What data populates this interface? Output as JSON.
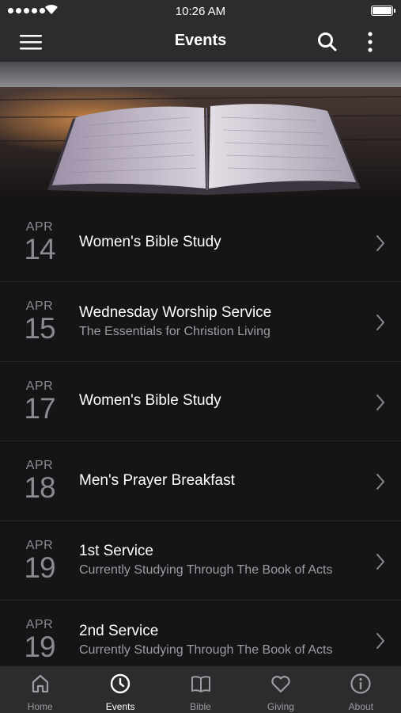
{
  "status_bar": {
    "time": "10:26 AM"
  },
  "nav": {
    "title": "Events",
    "menu_icon": "hamburger-menu-icon",
    "search_icon": "search-icon",
    "more_icon": "more-vertical-icon"
  },
  "hero": {
    "image": "open-bible-on-wooden-table-at-sunset"
  },
  "events": [
    {
      "month": "APR",
      "day": "14",
      "title": "Women's Bible Study",
      "subtitle": ""
    },
    {
      "month": "APR",
      "day": "15",
      "title": "Wednesday Worship Service",
      "subtitle": "The Essentials for Christion Living"
    },
    {
      "month": "APR",
      "day": "17",
      "title": "Women's Bible Study",
      "subtitle": ""
    },
    {
      "month": "APR",
      "day": "18",
      "title": "Men's Prayer Breakfast",
      "subtitle": ""
    },
    {
      "month": "APR",
      "day": "19",
      "title": "1st Service",
      "subtitle": "Currently Studying Through The Book of Acts"
    },
    {
      "month": "APR",
      "day": "19",
      "title": "2nd Service",
      "subtitle": "Currently Studying Through The Book of Acts"
    }
  ],
  "tabs": [
    {
      "label": "Home",
      "icon": "home-icon",
      "active": false
    },
    {
      "label": "Events",
      "icon": "clock-icon",
      "active": true
    },
    {
      "label": "Bible",
      "icon": "book-icon",
      "active": false
    },
    {
      "label": "Giving",
      "icon": "heart-icon",
      "active": false
    },
    {
      "label": "About",
      "icon": "info-icon",
      "active": false
    }
  ],
  "colors": {
    "bar_background": "#2b2c2e",
    "list_background": "#141517",
    "muted_text": "#9c9da0",
    "active_tab": "#ffffff"
  }
}
